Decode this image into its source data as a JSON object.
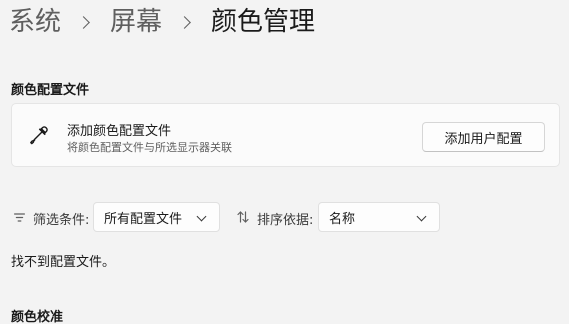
{
  "breadcrumb": {
    "items": [
      "系统",
      "屏幕"
    ],
    "current": "颜色管理"
  },
  "profiles_section": {
    "title": "颜色配置文件",
    "add_card": {
      "title": "添加颜色配置文件",
      "subtitle": "将颜色配置文件与所选显示器关联",
      "icon": "eyedropper-icon",
      "button_label": "添加用户配置"
    }
  },
  "filters": {
    "filter_label": "筛选条件:",
    "filter_value": "所有配置文件",
    "sort_label": "排序依据:",
    "sort_value": "名称"
  },
  "empty_message": "找不到配置文件。",
  "calibration_section": {
    "title": "颜色校准"
  }
}
